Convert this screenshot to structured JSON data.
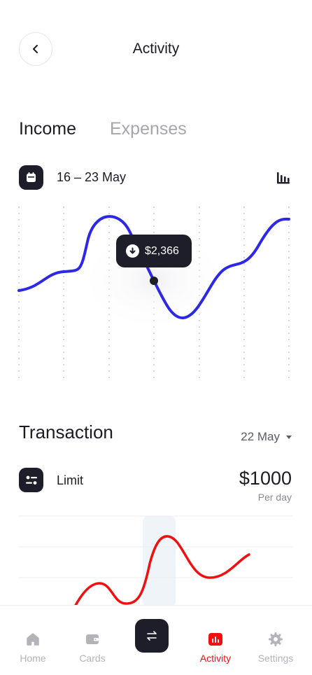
{
  "header": {
    "title": "Activity",
    "back_icon": "chevron-left-icon"
  },
  "tabs": [
    {
      "label": "Income",
      "active": true
    },
    {
      "label": "Expenses",
      "active": false
    }
  ],
  "date_range": {
    "label": "16 – 23 May",
    "icon": "calendar-icon",
    "chart_toggle_icon": "bar-chart-icon"
  },
  "income_chart": {
    "tooltip_value": "$2,366",
    "tooltip_icon": "arrow-down-circle-icon",
    "line_color": "#2d28e8"
  },
  "transaction": {
    "title": "Transaction",
    "date_filter": "22 May",
    "limit": {
      "label": "Limit",
      "amount": "$1000",
      "period": "Per day",
      "icon": "sliders-icon"
    },
    "chart_line_color": "#f10f0f"
  },
  "tabbar": {
    "items": [
      {
        "label": "Home",
        "icon": "home-icon",
        "active": false
      },
      {
        "label": "Cards",
        "icon": "wallet-icon",
        "active": false
      },
      {
        "label": "",
        "icon": "transfer-icon",
        "active": false
      },
      {
        "label": "Activity",
        "icon": "activity-chart-icon",
        "active": true
      },
      {
        "label": "Settings",
        "icon": "gear-icon",
        "active": false
      }
    ],
    "active_color": "#f10f0f"
  }
}
